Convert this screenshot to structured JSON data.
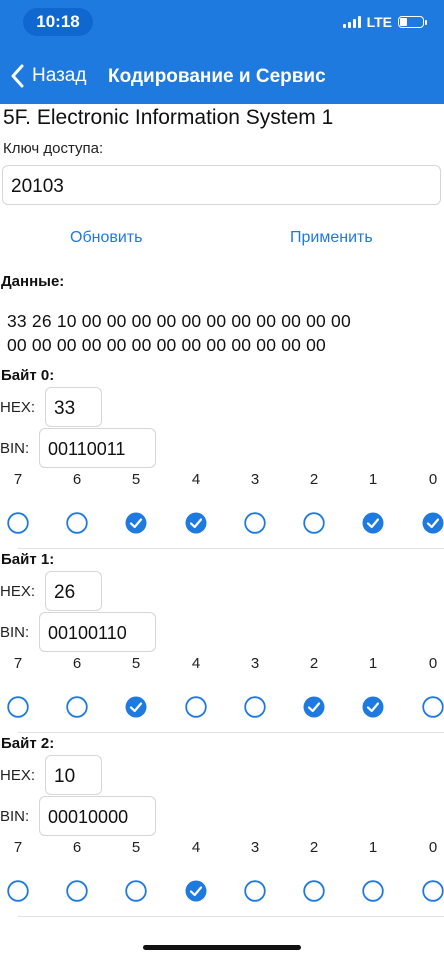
{
  "status_bar": {
    "time": "10:18",
    "network": "LTE",
    "battery_percent": 30
  },
  "nav": {
    "back_label": "Назад",
    "title": "Кодирование и Сервис"
  },
  "ecu_title": "5F. Electronic Information System 1",
  "access_key": {
    "label": "Ключ доступа:",
    "value": "20103"
  },
  "actions": {
    "refresh": "Обновить",
    "apply": "Применить"
  },
  "data": {
    "label": "Данные:",
    "line1": "33 26 10 00 00 00 00 00 00 00 00 00 00 00",
    "line2": "00 00 00 00 00 00 00 00 00 00 00 00 00"
  },
  "field_labels": {
    "hex": "HEX:",
    "bin": "BIN:"
  },
  "bit_numbers": [
    "7",
    "6",
    "5",
    "4",
    "3",
    "2",
    "1",
    "0"
  ],
  "bytes": [
    {
      "label": "Байт 0:",
      "hex": "33",
      "bin": "00110011",
      "bits": [
        0,
        0,
        1,
        1,
        0,
        0,
        1,
        1
      ]
    },
    {
      "label": "Байт 1:",
      "hex": "26",
      "bin": "00100110",
      "bits": [
        0,
        0,
        1,
        0,
        0,
        1,
        1,
        0
      ]
    },
    {
      "label": "Байт 2:",
      "hex": "10",
      "bin": "00010000",
      "bits": [
        0,
        0,
        0,
        1,
        0,
        0,
        0,
        0
      ]
    }
  ],
  "colors": {
    "accent": "#1f7ae0",
    "header": "#1f7ae0",
    "divider": "#e2e2e2"
  }
}
